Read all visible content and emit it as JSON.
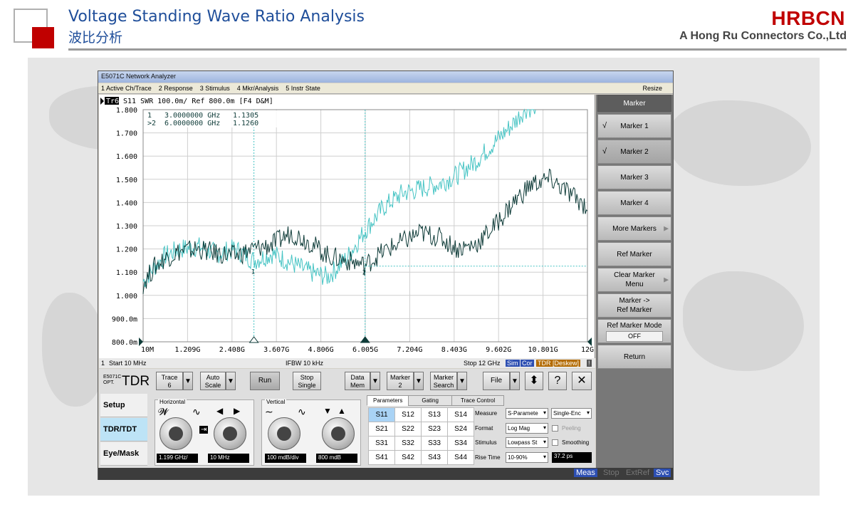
{
  "slide": {
    "title": "Voltage Standing Wave Ratio Analysis",
    "subtitle": "波比分析",
    "brand": "HRBCN",
    "brand_sub": "A Hong Ru Connectors Co.,Ltd"
  },
  "window": {
    "title": "E5071C Network Analyzer",
    "menu": [
      "1 Active Ch/Trace",
      "2 Response",
      "3 Stimulus",
      "4 Mkr/Analysis",
      "5 Instr State"
    ],
    "resize": "Resize"
  },
  "trace_header": {
    "tag": "Tr6",
    "text": "S11  SWR 100.0m/ Ref 800.0m [F4 D&M]"
  },
  "markers": [
    {
      "label": "1",
      "freq": "3.0000000 GHz",
      "value": "1.1305"
    },
    {
      "label": ">2",
      "freq": "6.0000000 GHz",
      "value": "1.1260"
    }
  ],
  "status": {
    "channel": "1",
    "start": "Start 10 MHz",
    "ifbw": "IFBW 10 kHz",
    "stop": "Stop 12 GHz",
    "tags": [
      "Sim",
      "Cor",
      "TDR [Deskew]",
      "!"
    ]
  },
  "softkeys": {
    "header": "Marker",
    "items": [
      {
        "label": "Marker 1",
        "checked": "√"
      },
      {
        "label": "Marker 2",
        "checked": "√"
      },
      {
        "label": "Marker 3"
      },
      {
        "label": "Marker 4"
      },
      {
        "label": "More Markers"
      },
      {
        "label": "Ref Marker"
      },
      {
        "label": "Clear Marker",
        "label2": "Menu"
      },
      {
        "label": "Marker ->",
        "label2": "Ref Marker"
      },
      {
        "label": "Ref Marker Mode",
        "value": "OFF"
      },
      {
        "label": "Return"
      }
    ]
  },
  "tdr": {
    "model": "E5071C",
    "opt": "OPT.",
    "mode": "TDR",
    "toolbar": {
      "trace": [
        "Trace",
        "6"
      ],
      "autoscale": [
        "Auto",
        "Scale"
      ],
      "run": "Run",
      "stop": [
        "Stop",
        "Single"
      ],
      "datamem": [
        "Data",
        "Mem"
      ],
      "marker": [
        "Marker",
        "2"
      ],
      "markersearch": [
        "Marker",
        "Search"
      ],
      "file": "File",
      "help": "?",
      "close": "✕",
      "updown": "⬍"
    },
    "tabs_side": [
      "Setup",
      "TDR/TDT",
      "Eye/Mask"
    ],
    "horizontal": {
      "label": "Horizontal",
      "scale": "1.199 GHz/",
      "start": "10 MHz"
    },
    "vertical": {
      "label": "Vertical",
      "scale": "100 mdB/div",
      "ref": "800 mdB"
    },
    "param_tabs": [
      "Parameters",
      "Gating",
      "Trace Control"
    ],
    "sparams": [
      [
        "S11",
        "S12",
        "S13",
        "S14"
      ],
      [
        "S21",
        "S22",
        "S23",
        "S24"
      ],
      [
        "S31",
        "S32",
        "S33",
        "S34"
      ],
      [
        "S41",
        "S42",
        "S43",
        "S44"
      ]
    ],
    "props": {
      "measure_label": "Measure",
      "measure": "S-Paramete",
      "measure2": "Single-Enc",
      "format_label": "Format",
      "format": "Log Mag",
      "peeling": "Peeling",
      "stimulus_label": "Stimulus",
      "stimulus": "Lowpass St",
      "smoothing": "Smoothing",
      "risetime_label": "Rise Time",
      "risetime": "10-90%",
      "risetime_value": "37.2 ps"
    }
  },
  "bottombar": [
    "Meas",
    "Stop",
    "ExtRef",
    "Svc"
  ],
  "chart_data": {
    "type": "line",
    "title": "",
    "ylim": [
      0.8,
      1.8
    ],
    "xlim": [
      0.01,
      12
    ],
    "y_ticks": [
      "1.800",
      "1.700",
      "1.600",
      "1.500",
      "1.400",
      "1.300",
      "1.200",
      "1.100",
      "1.000",
      "900.0m",
      "800.0m"
    ],
    "x_ticks": [
      "10M",
      "1.209G",
      "2.408G",
      "3.607G",
      "4.806G",
      "6.005G",
      "7.204G",
      "8.403G",
      "9.602G",
      "10.801G",
      "12G"
    ],
    "series": [
      {
        "color": "#47c4c4",
        "x": [
          0.01,
          0.3,
          0.6,
          1.0,
          1.5,
          2.0,
          2.5,
          3.0,
          3.5,
          4.0,
          4.5,
          5.0,
          5.5,
          6.0,
          6.5,
          7.0,
          7.5,
          8.0,
          8.5,
          9.0,
          9.5,
          10.0,
          10.3,
          10.6
        ],
        "y": [
          1.06,
          1.12,
          1.17,
          1.2,
          1.21,
          1.18,
          1.2,
          1.15,
          1.18,
          1.14,
          1.1,
          1.08,
          1.16,
          1.28,
          1.38,
          1.44,
          1.46,
          1.48,
          1.52,
          1.58,
          1.66,
          1.74,
          1.8,
          1.82
        ]
      },
      {
        "color": "#0e3b38",
        "x": [
          0.01,
          0.3,
          0.6,
          1.0,
          1.5,
          2.0,
          2.5,
          3.0,
          3.5,
          4.0,
          4.5,
          5.0,
          5.5,
          6.0,
          6.5,
          7.0,
          7.5,
          8.0,
          8.5,
          9.0,
          9.5,
          10.0,
          10.5,
          11.0,
          11.5,
          12.0
        ],
        "y": [
          1.05,
          1.12,
          1.16,
          1.19,
          1.2,
          1.18,
          1.17,
          1.2,
          1.22,
          1.27,
          1.23,
          1.17,
          1.15,
          1.13,
          1.19,
          1.23,
          1.27,
          1.25,
          1.2,
          1.22,
          1.3,
          1.4,
          1.48,
          1.5,
          1.44,
          1.38
        ]
      }
    ],
    "marker_points": [
      {
        "label": "1",
        "x": 3.0,
        "y": 1.1305
      },
      {
        "label": "2",
        "x": 6.0,
        "y": 1.126
      }
    ]
  }
}
